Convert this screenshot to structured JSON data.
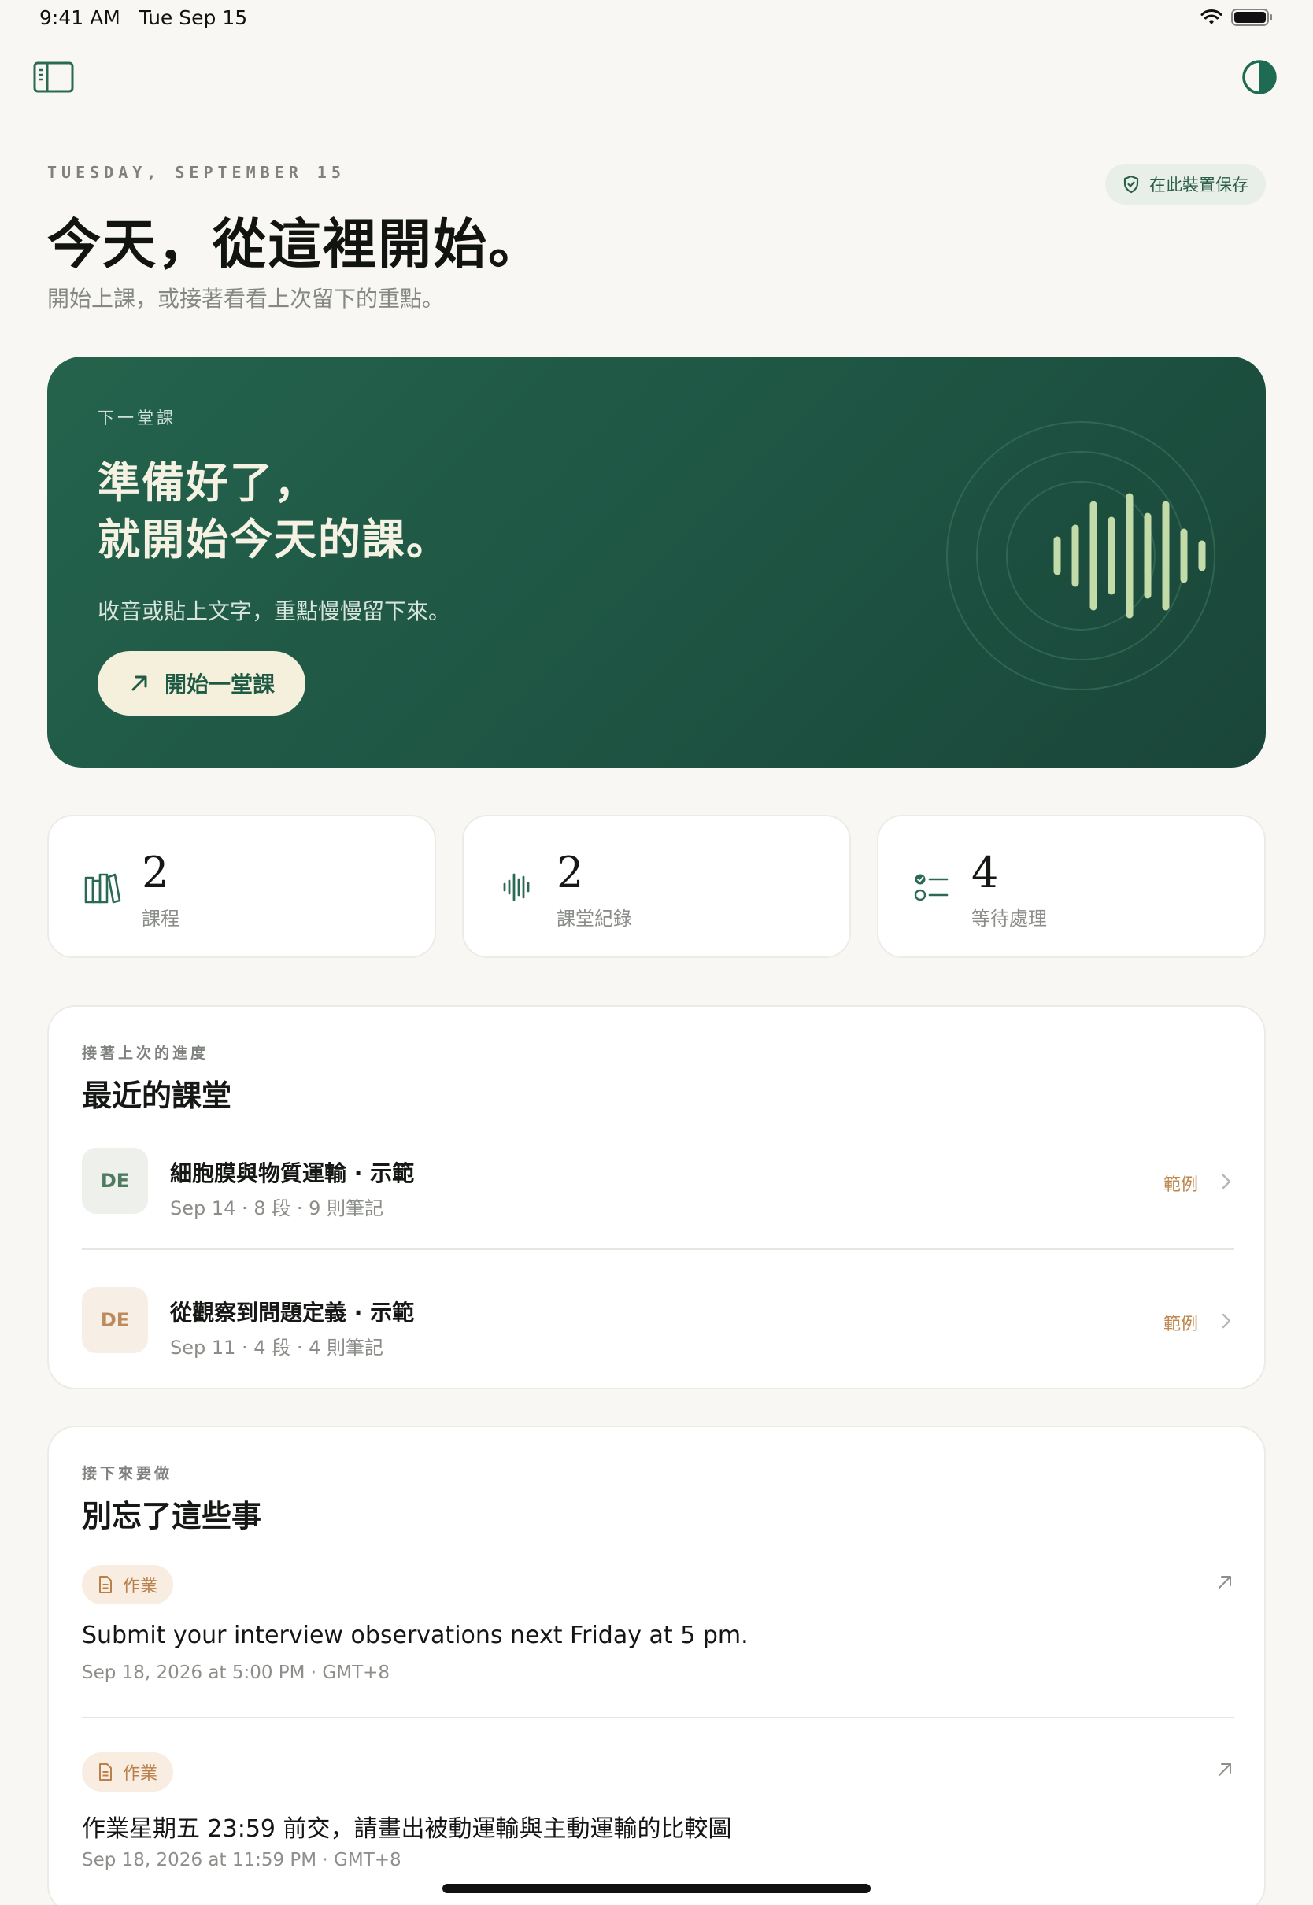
{
  "status_bar": {
    "time": "9:41 AM",
    "date": "Tue Sep 15"
  },
  "header": {
    "date_label": "TUESDAY, SEPTEMBER 15",
    "save_chip": "在此裝置保存",
    "title": "今天，從這裡開始。",
    "subtitle": "開始上課，或接著看看上次留下的重點。"
  },
  "hero": {
    "kicker": "下一堂課",
    "title_line1": "準備好了，",
    "title_line2": "就開始今天的課。",
    "subtitle": "收音或貼上文字，重點慢慢留下來。",
    "button_label": "開始一堂課"
  },
  "stats": [
    {
      "value": "2",
      "label": "課程",
      "icon": "books-icon"
    },
    {
      "value": "2",
      "label": "課堂紀錄",
      "icon": "waveform-icon"
    },
    {
      "value": "4",
      "label": "等待處理",
      "icon": "checklist-icon"
    }
  ],
  "recent": {
    "kicker": "接著上次的進度",
    "title": "最近的課堂",
    "items": [
      {
        "badge": "DE",
        "title": "細胞膜與物質運輸 · 示範",
        "meta": "Sep 14  ·  8 段 · 9 則筆記",
        "tag": "範例",
        "badge_color": "#4e7a5f",
        "badge_bg": "#eef0ec"
      },
      {
        "badge": "DE",
        "title": "從觀察到問題定義 · 示範",
        "meta": "Sep 11  ·  4 段 · 4 則筆記",
        "tag": "範例",
        "badge_color": "#bd8a5c",
        "badge_bg": "#f7efe6"
      }
    ]
  },
  "todos": {
    "kicker": "接下來要做",
    "title": "別忘了這些事",
    "items": [
      {
        "chip": "作業",
        "title": "Submit your interview observations next Friday at 5 pm.",
        "date": "Sep 18, 2026 at 5:00 PM · GMT+8"
      },
      {
        "chip": "作業",
        "title": "作業星期五 23:59 前交，請畫出被動運輸與主動運輸的比較圖",
        "date": "Sep 18, 2026 at 11:59 PM · GMT+8"
      }
    ]
  },
  "colors": {
    "accent": "#1f5a45",
    "background": "#f8f7f3",
    "warm": "#bd874e"
  }
}
